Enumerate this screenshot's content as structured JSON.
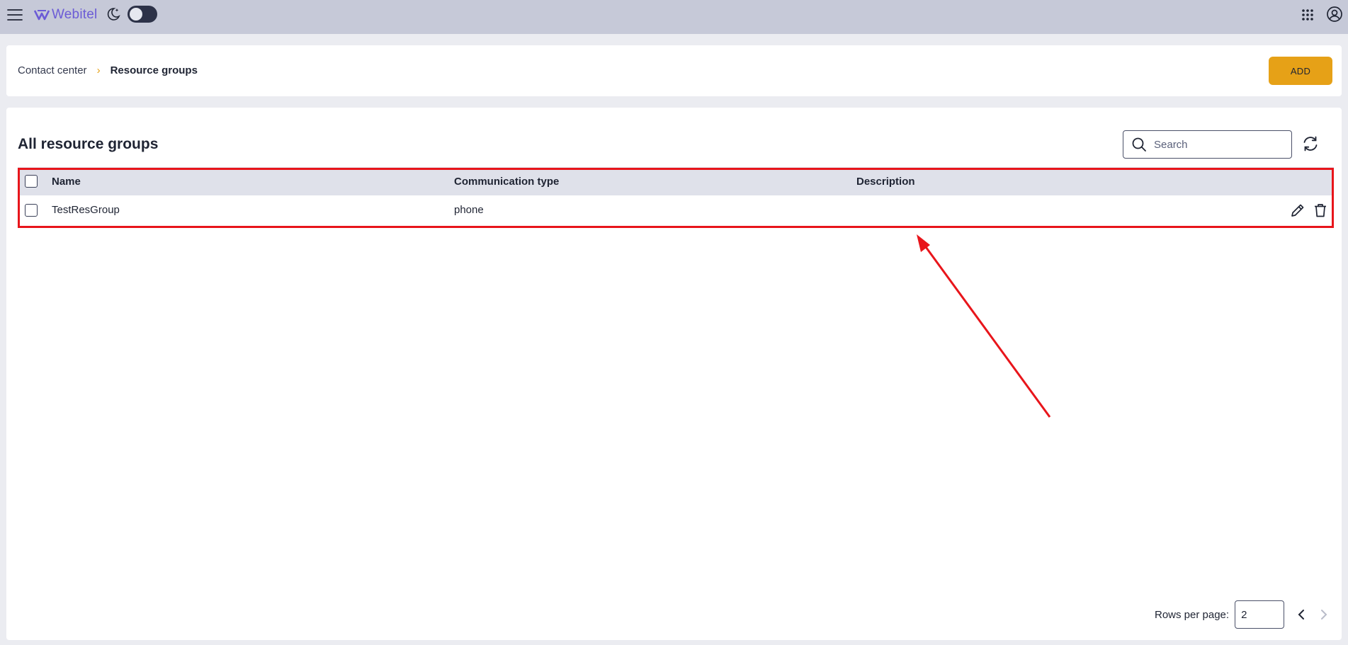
{
  "topbar": {
    "logo_text": "Webitel",
    "theme_toggle_on": false,
    "colors": {
      "bar": "#c6c9d8",
      "logo": "#6b5bd6"
    }
  },
  "breadcrumb": {
    "items": [
      "Contact center",
      "Resource groups"
    ],
    "separator": "›"
  },
  "header": {
    "add_label": "ADD",
    "accent": "#e6a117"
  },
  "main": {
    "title": "All resource groups",
    "search": {
      "placeholder": "Search",
      "value": ""
    }
  },
  "table": {
    "columns": [
      "Name",
      "Communication type",
      "Description"
    ],
    "rows": [
      {
        "name": "TestResGroup",
        "communication_type": "phone",
        "description": ""
      }
    ]
  },
  "pagination": {
    "rows_per_page_label": "Rows per page:",
    "rows_per_page_value": "2"
  },
  "annotation": {
    "color": "#e8151b"
  }
}
